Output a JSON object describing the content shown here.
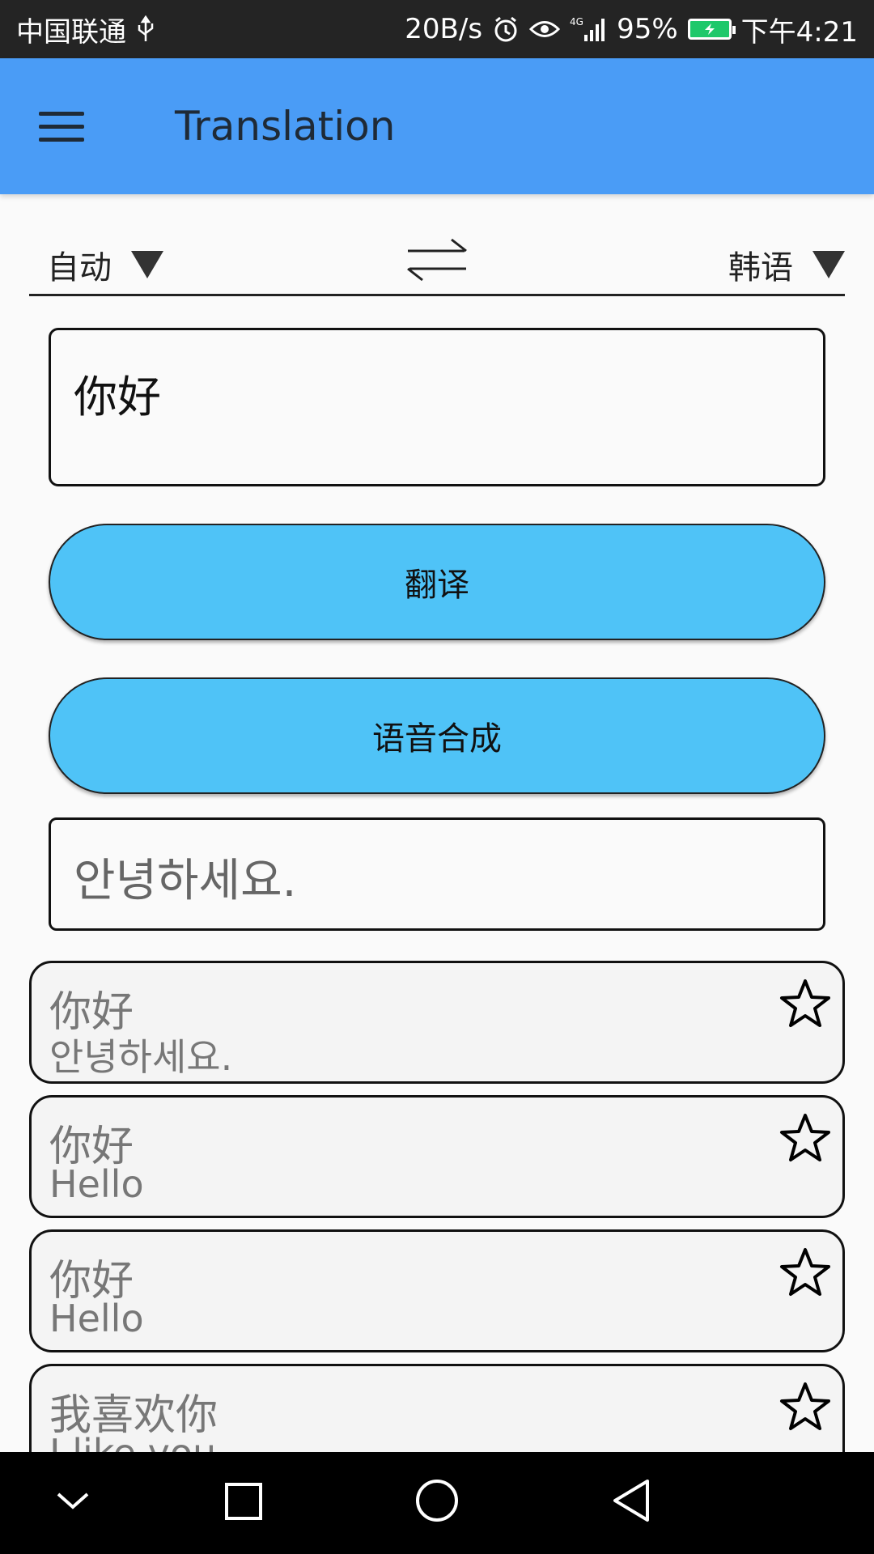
{
  "status_bar": {
    "carrier": "中国联通",
    "net_speed": "20B/s",
    "network": "4G",
    "battery": "95%",
    "time": "下午4:21"
  },
  "app_bar": {
    "title": "Translation"
  },
  "languages": {
    "source": "自动",
    "target": "韩语"
  },
  "input": {
    "value": "你好"
  },
  "buttons": {
    "translate": "翻译",
    "speech": "语音合成"
  },
  "output": {
    "value": "안녕하세요."
  },
  "history": [
    {
      "source": "你好",
      "translation": "안녕하세요."
    },
    {
      "source": "你好",
      "translation": "Hello"
    },
    {
      "source": "你好",
      "translation": "Hello"
    },
    {
      "source": "我喜欢你",
      "translation": "I like you"
    }
  ],
  "icons": {
    "menu": "hamburger-icon",
    "swap": "swap-arrows-icon",
    "dropdown": "triangle-down-icon",
    "favorite": "star-outline-icon",
    "nav_down": "chevron-down-icon",
    "nav_recents": "square-icon",
    "nav_home": "circle-icon",
    "nav_back": "triangle-back-icon"
  },
  "colors": {
    "app_bar": "#4a9cf6",
    "button": "#4fc3f7",
    "battery": "#1ec86a"
  }
}
